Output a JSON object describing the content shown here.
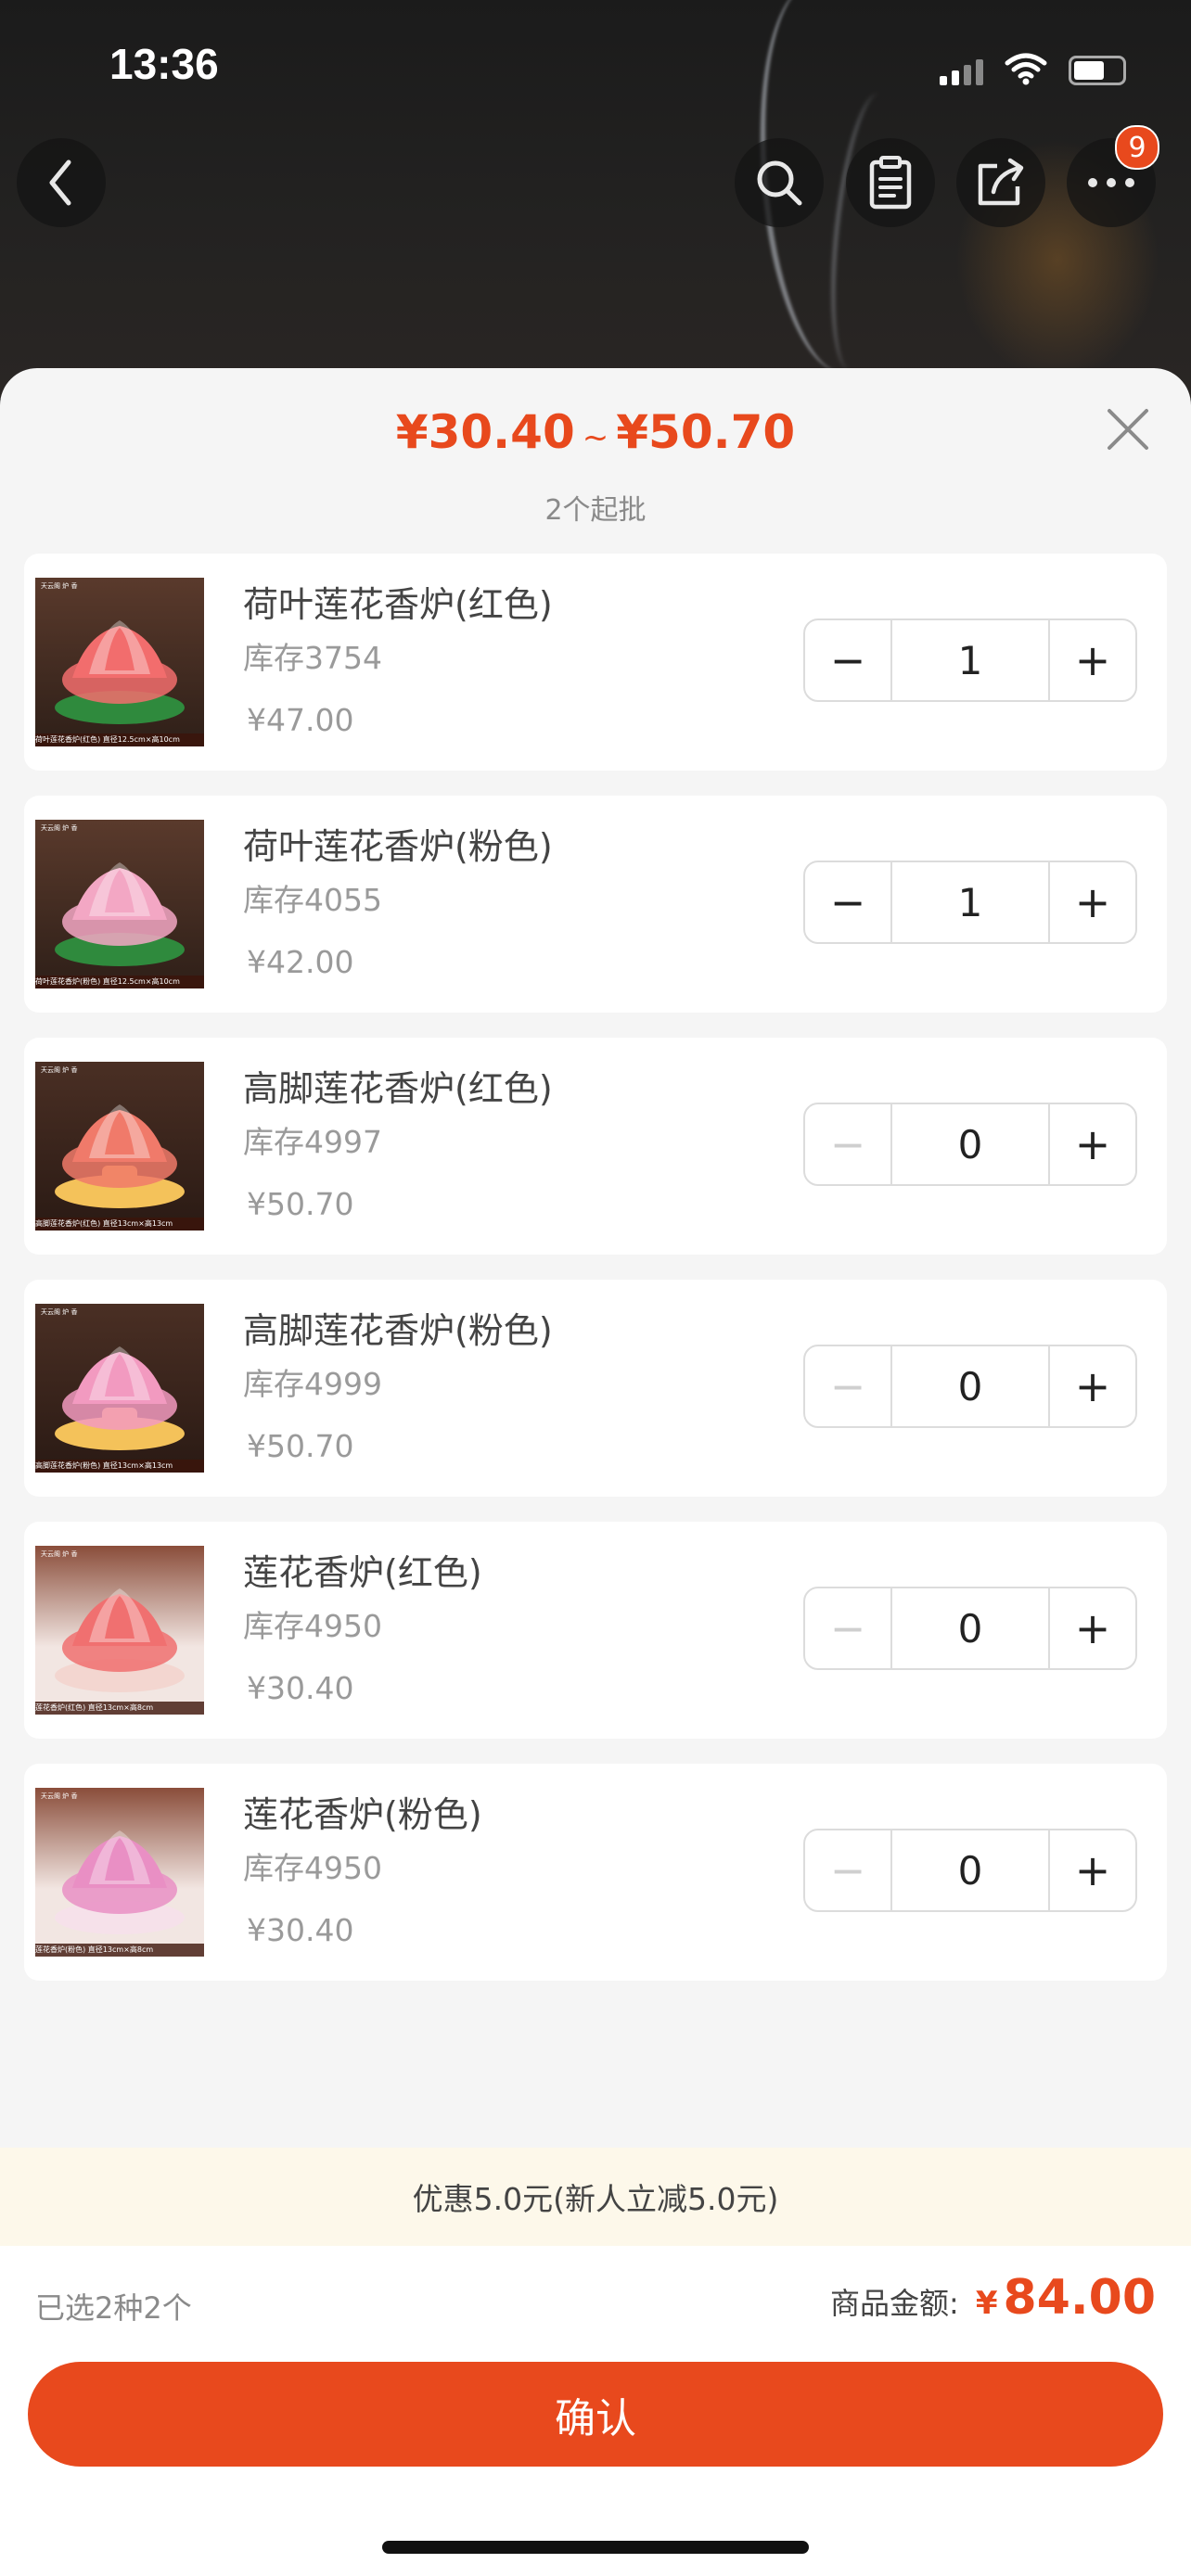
{
  "status_bar": {
    "time": "13:36"
  },
  "header": {
    "cart_badge": "9"
  },
  "sheet": {
    "price_range": {
      "low": "¥30.40",
      "separator": "~",
      "high": "¥50.70"
    },
    "moq": "2个起批"
  },
  "items": [
    {
      "name": "荷叶莲花香炉(红色)",
      "stock": "库存3754",
      "price": "¥47.00",
      "qty": "1",
      "minus_enabled": true,
      "thumb_tag": "天云阁 炉 香",
      "thumb_caption": "荷叶莲花香炉(红色)  直径12.5cm×高10cm",
      "petal_color": "#f26d6d",
      "base_color": "#2f8a3d"
    },
    {
      "name": "荷叶莲花香炉(粉色)",
      "stock": "库存4055",
      "price": "¥42.00",
      "qty": "1",
      "minus_enabled": true,
      "thumb_tag": "天云阁 炉 香",
      "thumb_caption": "荷叶莲花香炉(粉色)  直径12.5cm×高10cm",
      "petal_color": "#f3a7c4",
      "base_color": "#2f8a3d"
    },
    {
      "name": "高脚莲花香炉(红色)",
      "stock": "库存4997",
      "price": "¥50.70",
      "qty": "0",
      "minus_enabled": false,
      "thumb_tag": "天云阁 炉 香",
      "thumb_caption": "高脚莲花香炉(红色)  直径13cm×高13cm",
      "petal_color": "#f07a6a",
      "base_color": "#f4c25a"
    },
    {
      "name": "高脚莲花香炉(粉色)",
      "stock": "库存4999",
      "price": "¥50.70",
      "qty": "0",
      "minus_enabled": false,
      "thumb_tag": "天云阁 炉 香",
      "thumb_caption": "高脚莲花香炉(粉色)  直径13cm×高13cm",
      "petal_color": "#f29ac0",
      "base_color": "#f4c25a"
    },
    {
      "name": "莲花香炉(红色)",
      "stock": "库存4950",
      "price": "¥30.40",
      "qty": "0",
      "minus_enabled": false,
      "thumb_tag": "天云阁 炉 香",
      "thumb_caption": "莲花香炉(红色)  直径13cm×高8cm",
      "petal_color": "#f07070",
      "base_color": "#f3d6d0"
    },
    {
      "name": "莲花香炉(粉色)",
      "stock": "库存4950",
      "price": "¥30.40",
      "qty": "0",
      "minus_enabled": false,
      "thumb_tag": "天云阁 炉 香",
      "thumb_caption": "莲花香炉(粉色)  直径13cm×高8cm",
      "petal_color": "#e98fc4",
      "base_color": "#f6e1ea"
    }
  ],
  "stepper_labels": {
    "minus": "−",
    "plus": "+"
  },
  "discount_text": "优惠5.0元(新人立减5.0元)",
  "footer": {
    "selected_text": "已选2种2个",
    "total_label": "商品金额:",
    "currency": "¥",
    "total_value": "84.00",
    "confirm_label": "确认"
  },
  "colors": {
    "accent": "#e8491d",
    "discount_bg": "#fdf8ea"
  },
  "icons": [
    "back-icon",
    "search-icon",
    "clipboard-icon",
    "share-icon",
    "more-icon",
    "close-icon"
  ]
}
